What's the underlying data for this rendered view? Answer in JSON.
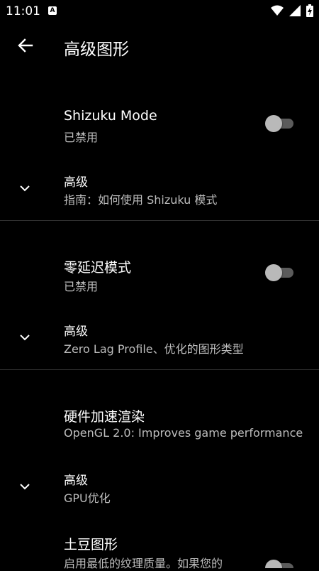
{
  "status_bar": {
    "time": "11:01",
    "notification_icon": "A",
    "icons": [
      "wifi-icon",
      "signal-icon",
      "battery-charging-icon"
    ]
  },
  "app_bar": {
    "title": "高级图形",
    "back_icon": "arrow-back-icon"
  },
  "sections": [
    {
      "toggle": {
        "title": "Shizuku Mode",
        "summary": "已禁用",
        "enabled": false
      },
      "advanced": {
        "title": "高级",
        "summary": "指南：如何使用 Shizuku 模式"
      }
    },
    {
      "toggle": {
        "title": "零延迟模式",
        "summary": "已禁用",
        "enabled": false
      },
      "advanced": {
        "title": "高级",
        "summary": "Zero Lag Profile、优化的图形类型"
      }
    },
    {
      "item": {
        "title": "硬件加速渲染",
        "summary": "OpenGL 2.0: Improves game performance"
      },
      "advanced": {
        "title": "高级",
        "summary": "GPU优化"
      }
    },
    {
      "toggle": {
        "title": "土豆图形",
        "summary": "启用最低的纹理质量。如果您的",
        "enabled": false
      }
    }
  ]
}
